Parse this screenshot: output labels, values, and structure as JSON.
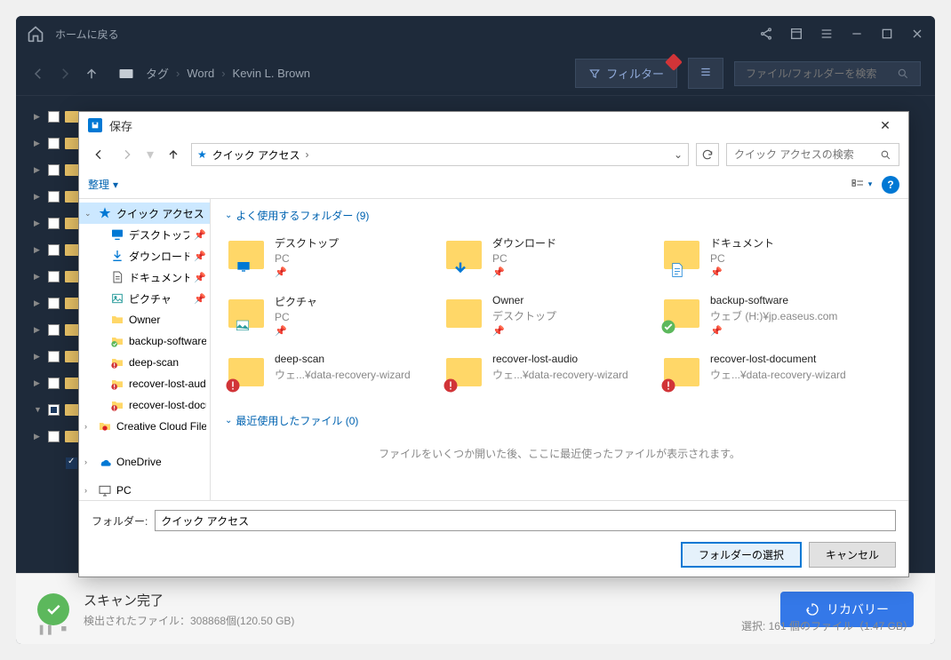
{
  "titlebar": {
    "home": "ホームに戻る"
  },
  "navbar": {
    "tag": "タグ",
    "bc1": "Word",
    "bc2": "Kevin L. Brown",
    "filter": "フィルター",
    "search_placeholder": "ファイル/フォルダーを検索"
  },
  "status": {
    "main": "スキャン完了",
    "sub": "検出されたファイル：308868個(120.50 GB)",
    "recovery": "リカバリー",
    "selection": "選択: 161 個のファイル（1.47 GB）"
  },
  "dialog": {
    "title": "保存",
    "address": "クイック アクセス",
    "search_placeholder": "クイック アクセスの検索",
    "organize": "整理",
    "folder_label": "フォルダー:",
    "folder_value": "クイック アクセス",
    "btn_select": "フォルダーの選択",
    "btn_cancel": "キャンセル",
    "section_frequent": "よく使用するフォルダー (9)",
    "section_recent": "最近使用したファイル (0)",
    "empty_recent": "ファイルをいくつか開いた後、ここに最近使ったファイルが表示されます。"
  },
  "sidebar": {
    "items": [
      {
        "label": "クイック アクセス",
        "icon": "star",
        "expanded": true,
        "selected": true,
        "pin": false
      },
      {
        "label": "デスクトップ",
        "icon": "desktop",
        "pin": true
      },
      {
        "label": "ダウンロード",
        "icon": "download",
        "pin": true
      },
      {
        "label": "ドキュメント",
        "icon": "document",
        "pin": true
      },
      {
        "label": "ピクチャ",
        "icon": "pictures",
        "pin": true
      },
      {
        "label": "Owner",
        "icon": "folder",
        "pin": false
      },
      {
        "label": "backup-software",
        "icon": "check-folder",
        "pin": false
      },
      {
        "label": "deep-scan",
        "icon": "warn-folder",
        "pin": false
      },
      {
        "label": "recover-lost-audio",
        "icon": "warn-folder",
        "pin": false
      },
      {
        "label": "recover-lost-document",
        "icon": "warn-folder",
        "pin": false
      },
      {
        "label": "Creative Cloud Files",
        "icon": "cc",
        "exp": true
      },
      {
        "label": "OneDrive",
        "icon": "onedrive",
        "exp": true
      },
      {
        "label": "PC",
        "icon": "pc",
        "exp": true
      }
    ]
  },
  "folders": [
    {
      "name": "デスクトップ",
      "loc": "PC",
      "pin": true,
      "icon": "desktop"
    },
    {
      "name": "ダウンロード",
      "loc": "PC",
      "pin": true,
      "icon": "download"
    },
    {
      "name": "ドキュメント",
      "loc": "PC",
      "pin": true,
      "icon": "document"
    },
    {
      "name": "ピクチャ",
      "loc": "PC",
      "pin": true,
      "icon": "pictures"
    },
    {
      "name": "Owner",
      "loc": "デスクトップ",
      "pin": true,
      "icon": "folder"
    },
    {
      "name": "backup-software",
      "loc": "ウェブ (H:)¥jp.easeus.com",
      "pin": true,
      "icon": "check"
    },
    {
      "name": "deep-scan",
      "loc": "ウェ...¥data-recovery-wizard",
      "pin": false,
      "icon": "warn"
    },
    {
      "name": "recover-lost-audio",
      "loc": "ウェ...¥data-recovery-wizard",
      "pin": false,
      "icon": "warn"
    },
    {
      "name": "recover-lost-document",
      "loc": "ウェ...¥data-recovery-wizard",
      "pin": false,
      "icon": "warn"
    }
  ]
}
